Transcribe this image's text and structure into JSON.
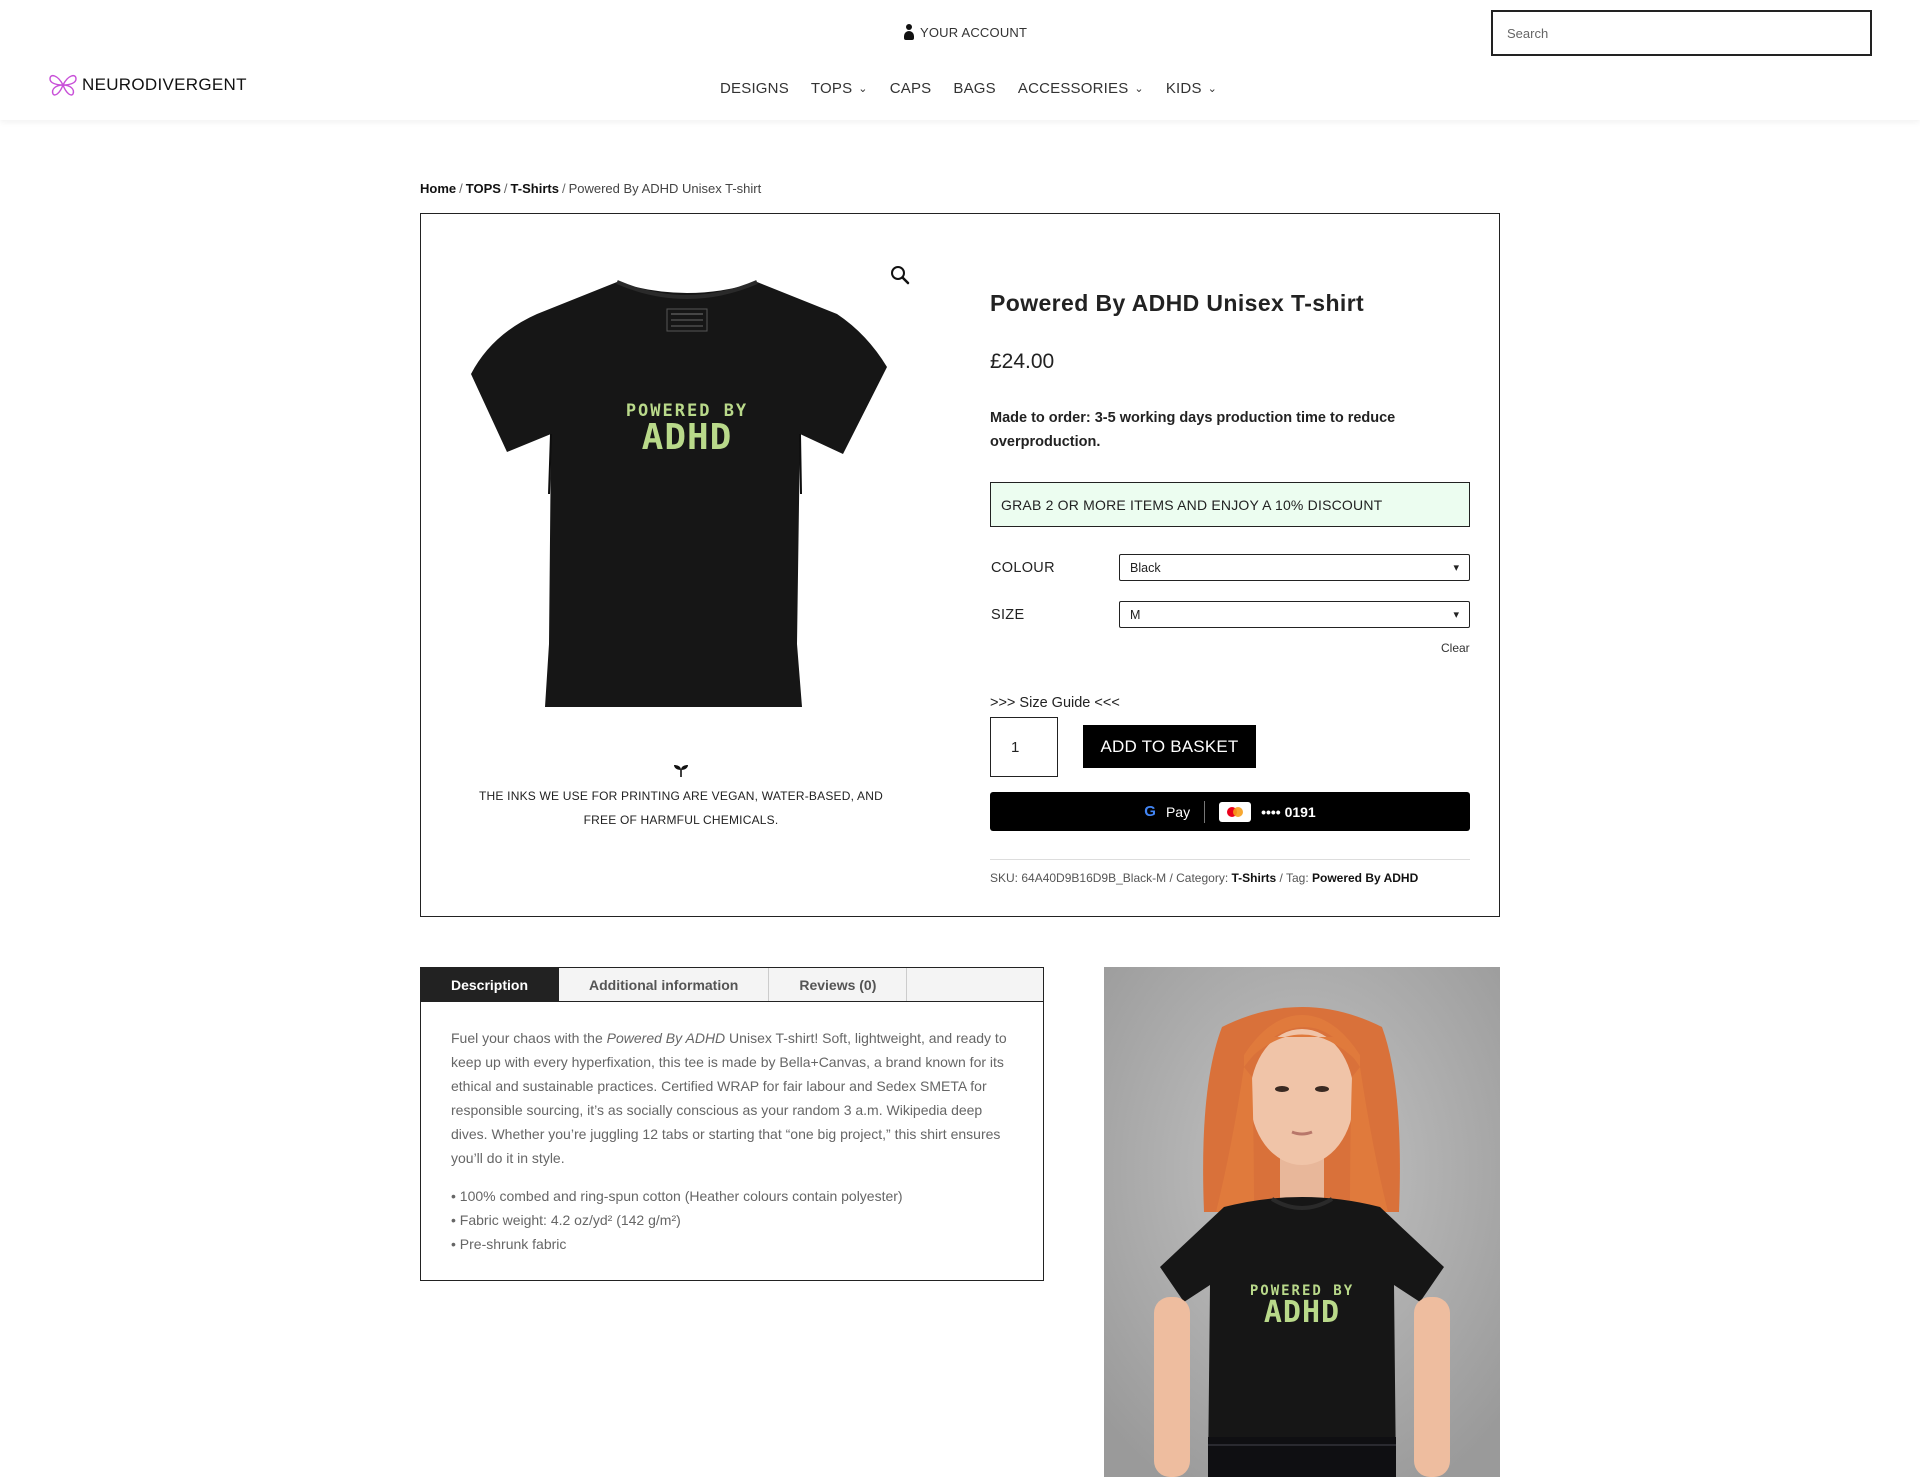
{
  "header": {
    "account_label": "YOUR ACCOUNT",
    "search_placeholder": "Search",
    "logo_text": "NEURODIVERGENT",
    "nav": [
      {
        "label": "DESIGNS",
        "has_dropdown": false
      },
      {
        "label": "TOPS",
        "has_dropdown": true
      },
      {
        "label": "CAPS",
        "has_dropdown": false
      },
      {
        "label": "BAGS",
        "has_dropdown": false
      },
      {
        "label": "ACCESSORIES",
        "has_dropdown": true
      },
      {
        "label": "KIDS",
        "has_dropdown": true
      }
    ]
  },
  "breadcrumb": {
    "home": "Home",
    "tops": "TOPS",
    "tshirts": "T-Shirts",
    "current": "Powered By ADHD Unisex T-shirt"
  },
  "product": {
    "shirt_print_line1": "POWERED BY",
    "shirt_print_line2": "ADHD",
    "eco_text": "THE INKS WE USE FOR PRINTING ARE VEGAN, WATER-BASED, AND FREE OF HARMFUL CHEMICALS.",
    "title": "Powered By ADHD Unisex T-shirt",
    "price": "£24.00",
    "note": "Made to order: 3-5 working days production time to reduce overproduction.",
    "discount": "GRAB 2 OR MORE ITEMS AND ENJOY A 10% DISCOUNT",
    "colour_label": "COLOUR",
    "colour_value": "Black",
    "size_label": "SIZE",
    "size_value": "M",
    "clear_label": "Clear",
    "size_guide": ">>> Size Guide <<<",
    "quantity": "1",
    "add_to_basket": "ADD TO BASKET",
    "gpay_pay": "Pay",
    "gpay_card_digits": "•••• 0191",
    "meta": {
      "sku_label": "SKU:",
      "sku": "64A40D9B16D9B_Black-M",
      "category_label": "Category:",
      "category": "T-Shirts",
      "tag_label": "Tag:",
      "tag": "Powered By ADHD"
    }
  },
  "tabs": {
    "items": [
      "Description",
      "Additional information",
      "Reviews (0)"
    ],
    "active": "Description",
    "desc_intro": "Fuel your chaos with the ",
    "desc_em": "Powered By ADHD",
    "desc_rest": " Unisex T-shirt! Soft, lightweight, and ready to keep up with every hyperfixation, this tee is made by Bella+Canvas, a brand known for its ethical and sustainable practices. Certified WRAP for fair labour and Sedex SMETA for responsible sourcing, it’s as socially conscious as your random 3 a.m. Wikipedia deep dives. Whether you’re juggling 12 tabs or starting that “one big project,” this shirt ensures you’ll do it in style.",
    "bullets": [
      "• 100% combed and ring-spun cotton (Heather colours contain polyester)",
      "• Fabric weight: 4.2 oz/yd² (142 g/m²)",
      "• Pre-shrunk fabric"
    ]
  },
  "colors": {
    "print_green": "#b9d98a",
    "discount_bg": "#ecfdf0",
    "hair": "#e07a3c",
    "shirt": "#161616"
  }
}
